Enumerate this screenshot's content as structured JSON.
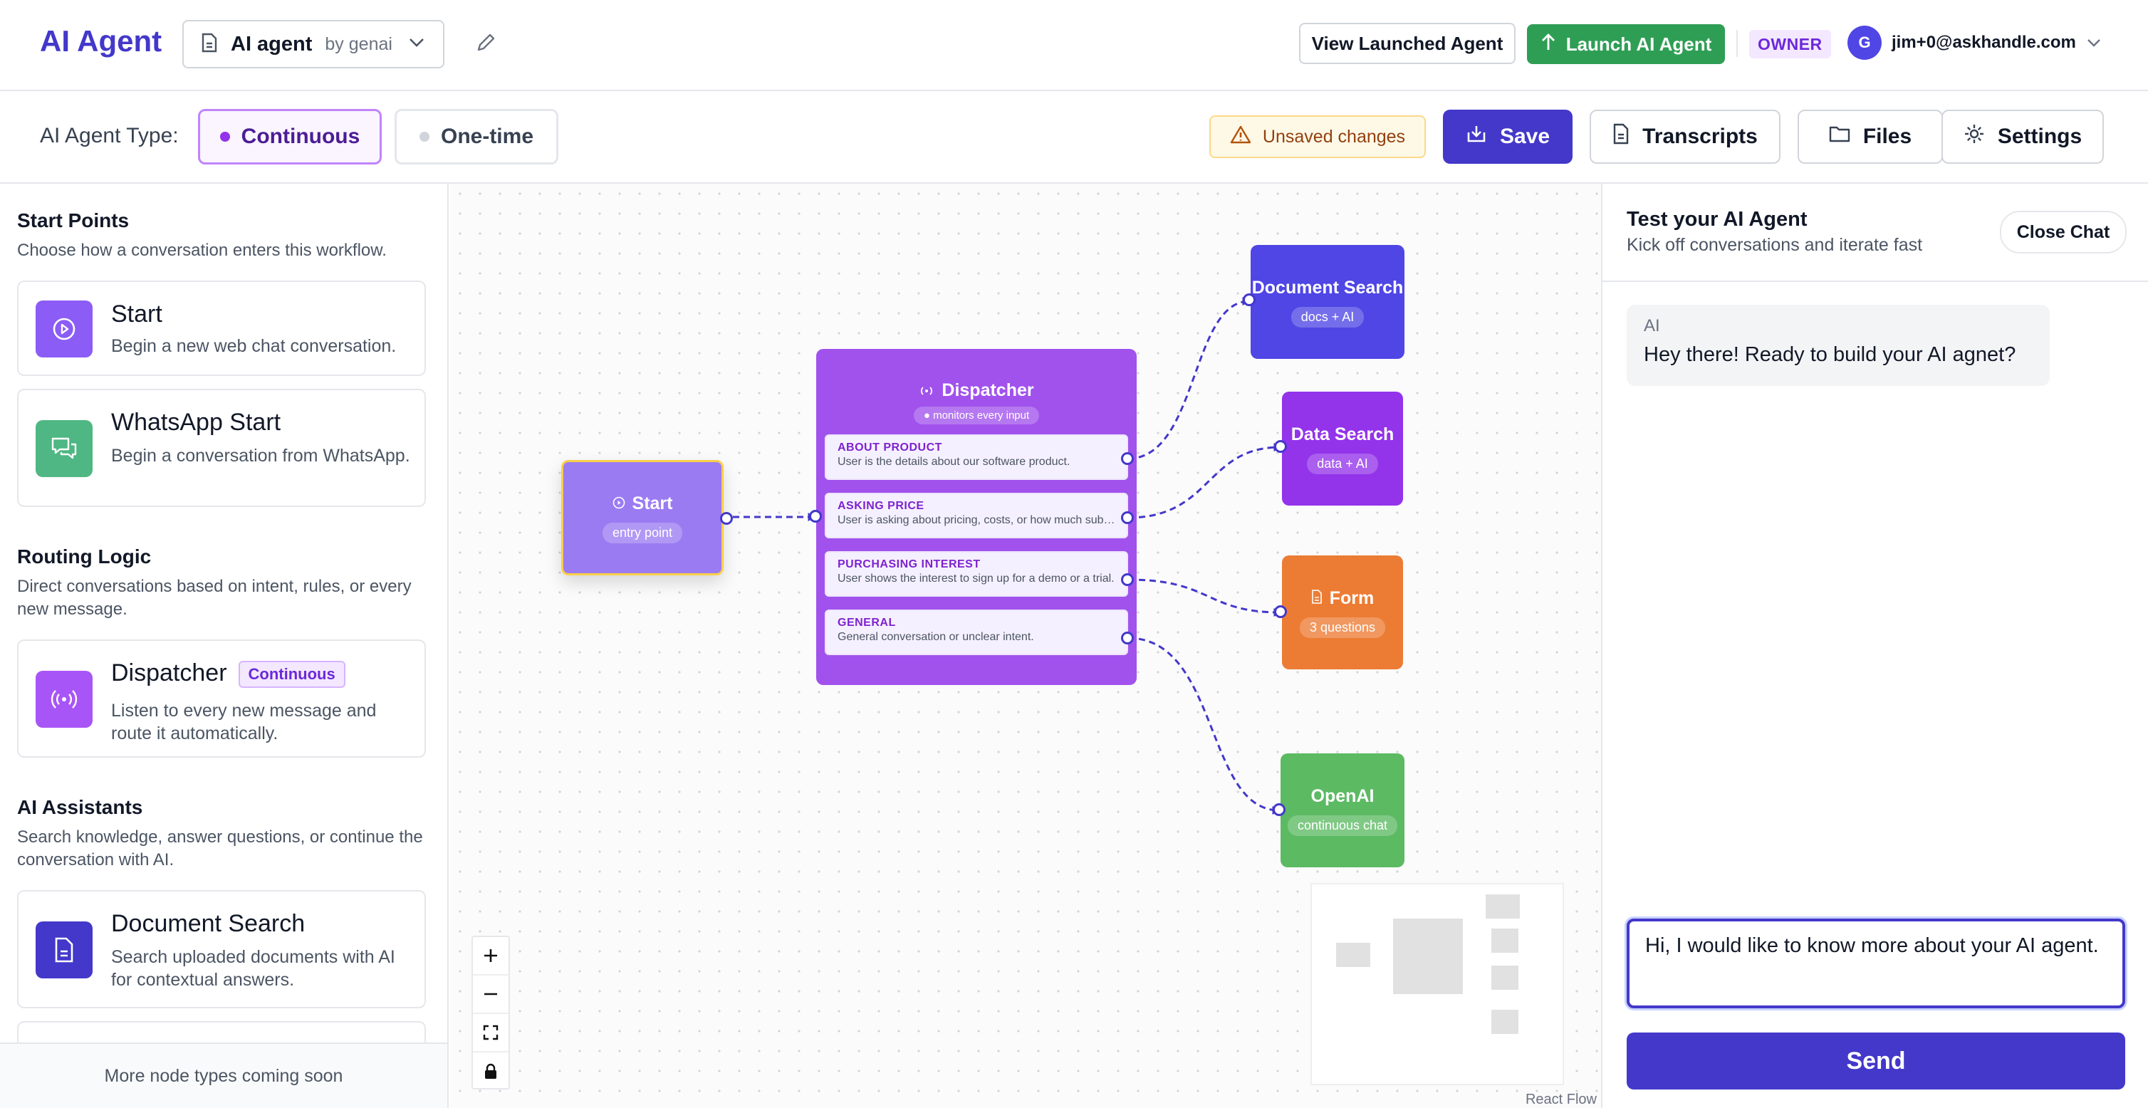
{
  "header": {
    "brand": "AI Agent",
    "agent_name": "AI agent",
    "agent_by": "by genai",
    "view_launched_label": "View Launched Agent",
    "launch_label": "Launch AI Agent",
    "role_badge": "OWNER",
    "user_initial": "G",
    "user_email": "jim+0@askhandle.com"
  },
  "toolbar": {
    "type_label": "AI Agent Type:",
    "type_options": [
      "Continuous",
      "One-time"
    ],
    "selected_type": "Continuous",
    "unsaved_label": "Unsaved changes",
    "save_label": "Save",
    "transcripts_label": "Transcripts",
    "files_label": "Files",
    "settings_label": "Settings"
  },
  "sidebar": {
    "start_points": {
      "title": "Start Points",
      "desc": "Choose how a conversation enters this workflow.",
      "items": [
        {
          "title": "Start",
          "desc": "Begin a new web chat conversation."
        },
        {
          "title": "WhatsApp Start",
          "desc": "Begin a conversation from WhatsApp."
        }
      ]
    },
    "routing": {
      "title": "Routing Logic",
      "desc": "Direct conversations based on intent, rules, or every new message.",
      "items": [
        {
          "title": "Dispatcher",
          "badge": "Continuous",
          "desc": "Listen to every new message and route it automatically."
        }
      ]
    },
    "assistants": {
      "title": "AI Assistants",
      "desc": "Search knowledge, answer questions, or continue the conversation with AI.",
      "items": [
        {
          "title": "Document Search",
          "desc": "Search uploaded documents with AI for contextual answers."
        }
      ]
    },
    "footer": "More node types coming soon"
  },
  "canvas": {
    "start_node": {
      "title": "Start",
      "subtitle": "entry point"
    },
    "dispatcher": {
      "title": "Dispatcher",
      "subtitle": "monitors every input",
      "routes": [
        {
          "label": "ABOUT PRODUCT",
          "desc": "User is the details about our software product."
        },
        {
          "label": "ASKING PRICE",
          "desc": "User is asking about pricing, costs, or how much subscription costs."
        },
        {
          "label": "PURCHASING INTEREST",
          "desc": "User shows the interest to sign up for a demo or a trial."
        },
        {
          "label": "GENERAL",
          "desc": "General conversation or unclear intent."
        }
      ]
    },
    "targets": {
      "doc": {
        "title": "Document Search",
        "subtitle": "docs + AI",
        "color": "#4f46e5"
      },
      "data": {
        "title": "Data Search",
        "subtitle": "data + AI",
        "color": "#9333ea"
      },
      "form": {
        "title": "Form",
        "subtitle": "3 questions",
        "color": "#ec7c34"
      },
      "openai": {
        "title": "OpenAI",
        "subtitle": "continuous chat",
        "color": "#5cba63"
      }
    },
    "attribution": "React Flow"
  },
  "chat": {
    "title": "Test your AI Agent",
    "subtitle": "Kick off conversations and iterate fast",
    "close_label": "Close Chat",
    "messages": [
      {
        "sender": "AI",
        "text": "Hey there! Ready to build your AI agnet?"
      }
    ],
    "input_value": "Hi, I would like to know more about your AI agent.",
    "send_label": "Send"
  }
}
